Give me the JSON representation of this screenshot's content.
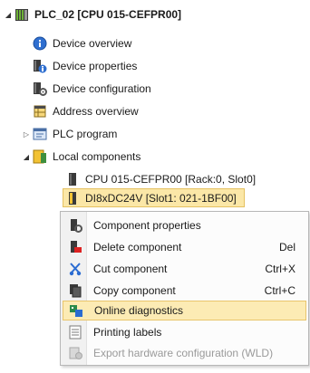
{
  "tree": {
    "plc_label": "PLC_02 [CPU 015-CEFPR00]",
    "children": [
      {
        "label": "Device overview"
      },
      {
        "label": "Device properties"
      },
      {
        "label": "Device configuration"
      },
      {
        "label": "Address overview"
      },
      {
        "label": "PLC program"
      },
      {
        "label": "Local components"
      }
    ],
    "local_components": [
      {
        "label": "CPU 015-CEFPR00 [Rack:0, Slot0]"
      },
      {
        "label": "DI8xDC24V [Slot1: 021-1BF00]"
      }
    ]
  },
  "context_menu": {
    "items": [
      {
        "label": "Component properties",
        "shortcut": ""
      },
      {
        "label": "Delete component",
        "shortcut": "Del"
      },
      {
        "label": "Cut component",
        "shortcut": "Ctrl+X"
      },
      {
        "label": "Copy component",
        "shortcut": "Ctrl+C"
      },
      {
        "label": "Online diagnostics",
        "shortcut": ""
      },
      {
        "label": "Printing labels",
        "shortcut": ""
      },
      {
        "label": "Export hardware configuration (WLD)",
        "shortcut": ""
      }
    ]
  },
  "colors": {
    "selection_bg": "#fbe7a7",
    "highlight_bg": "#fcebb4",
    "highlight_border": "#e9c56b",
    "disabled_text": "#9a9a9a"
  }
}
